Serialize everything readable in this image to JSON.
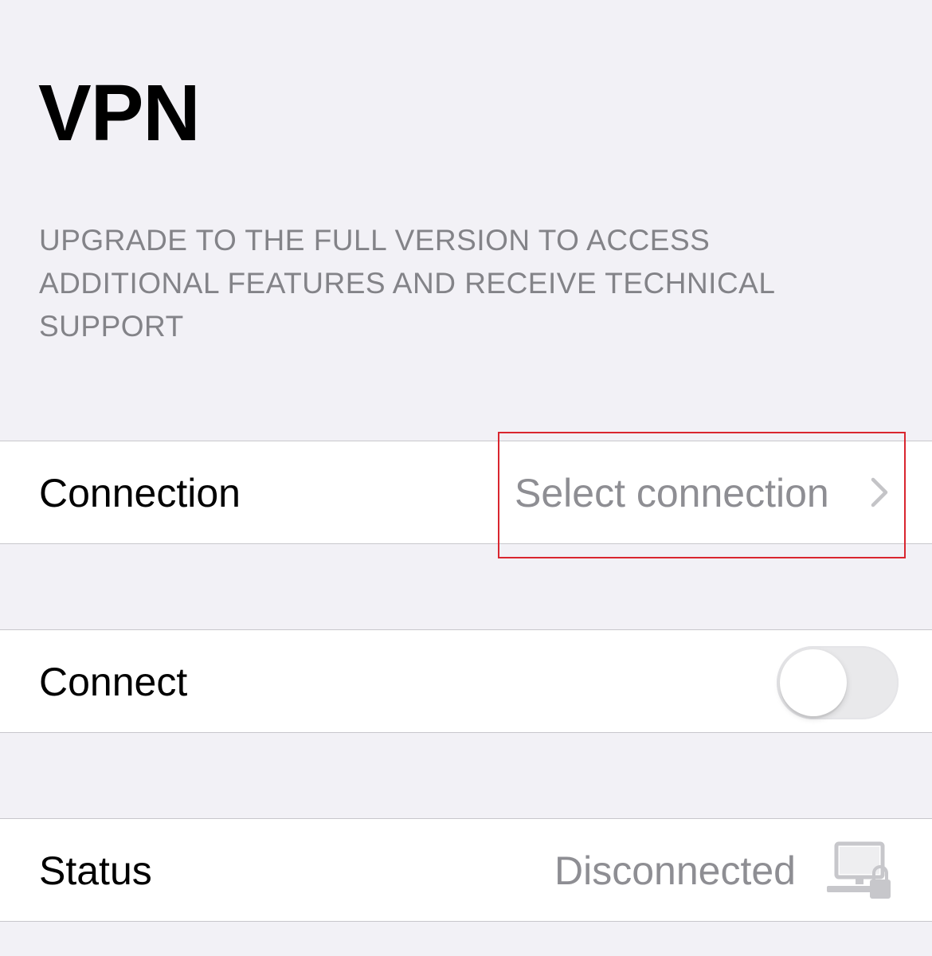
{
  "header": {
    "title": "VPN",
    "upgrade_notice": "UPGRADE TO THE FULL VERSION TO ACCESS ADDITIONAL FEATURES AND RECEIVE TECHNICAL SUPPORT"
  },
  "connection_row": {
    "label": "Connection",
    "value": "Select connection",
    "icon": "chevron-right-icon"
  },
  "connect_row": {
    "label": "Connect",
    "toggle_on": false
  },
  "status_row": {
    "label": "Status",
    "value": "Disconnected",
    "icon": "computer-lock-icon"
  },
  "colors": {
    "background": "#f2f1f6",
    "cell": "#ffffff",
    "secondary_text": "#8e8e93",
    "highlight": "#d9262f"
  }
}
